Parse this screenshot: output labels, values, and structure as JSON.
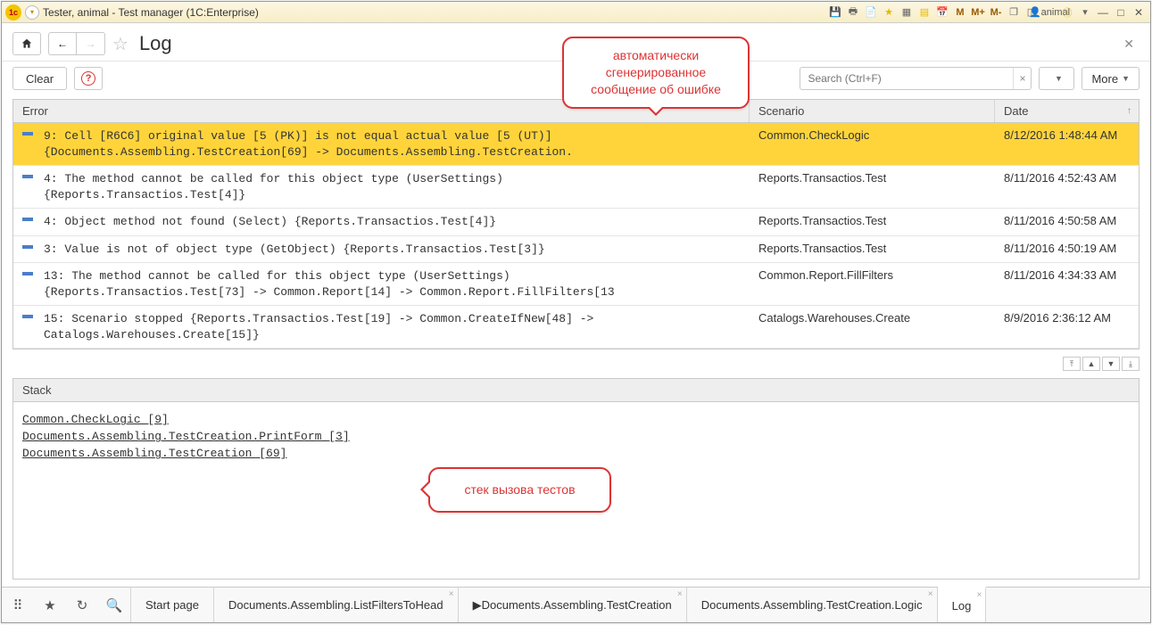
{
  "window": {
    "title": "Tester, animal  - Test manager (1C:Enterprise)",
    "user_label": "animal"
  },
  "memory_buttons": {
    "m": "M",
    "mplus": "M+",
    "mminus": "M-"
  },
  "page": {
    "title": "Log",
    "clear_label": "Clear",
    "more_label": "More"
  },
  "search": {
    "placeholder": "Search (Ctrl+F)",
    "value": ""
  },
  "table": {
    "headers": {
      "error": "Error",
      "scenario": "Scenario",
      "date": "Date"
    },
    "rows": [
      {
        "error": "9: Cell [R6C6] original value [5 (PK)] is not equal actual value [5 (UT)]\n{Documents.Assembling.TestCreation[69] -> Documents.Assembling.TestCreation.",
        "scenario": "Common.CheckLogic",
        "date": "8/12/2016 1:48:44 AM",
        "selected": true
      },
      {
        "error": "4: The method cannot be called for this object type (UserSettings)\n{Reports.Transactios.Test[4]}",
        "scenario": "Reports.Transactios.Test",
        "date": "8/11/2016 4:52:43 AM",
        "selected": false
      },
      {
        "error": "4: Object method not found (Select) {Reports.Transactios.Test[4]}",
        "scenario": "Reports.Transactios.Test",
        "date": "8/11/2016 4:50:58 AM",
        "selected": false
      },
      {
        "error": "3: Value is not of object type (GetObject) {Reports.Transactios.Test[3]}",
        "scenario": "Reports.Transactios.Test",
        "date": "8/11/2016 4:50:19 AM",
        "selected": false
      },
      {
        "error": "13: The method cannot be called for this object type (UserSettings)\n{Reports.Transactios.Test[73] -> Common.Report[14] -> Common.Report.FillFilters[13",
        "scenario": "Common.Report.FillFilters",
        "date": "8/11/2016 4:34:33 AM",
        "selected": false
      },
      {
        "error": "15: Scenario stopped {Reports.Transactios.Test[19] -> Common.CreateIfNew[48] ->\nCatalogs.Warehouses.Create[15]}",
        "scenario": "Catalogs.Warehouses.Create",
        "date": "8/9/2016 2:36:12 AM",
        "selected": false
      }
    ]
  },
  "stack": {
    "header": "Stack",
    "lines": [
      "Common.CheckLogic [9]",
      "Documents.Assembling.TestCreation.PrintForm [3]",
      "Documents.Assembling.TestCreation [69]"
    ]
  },
  "callouts": {
    "top": "автоматически\nсгенерированное\nсообщение об ошибке",
    "stack": "стек вызова тестов"
  },
  "tabs": [
    {
      "label": "Start page",
      "closable": false
    },
    {
      "label": "Documents.Assembling.ListFiltersToHead",
      "closable": true
    },
    {
      "label": "▶Documents.Assembling.TestCreation",
      "closable": true
    },
    {
      "label": "Documents.Assembling.TestCreation.Logic",
      "closable": true
    },
    {
      "label": "Log",
      "closable": true,
      "active": true
    }
  ]
}
